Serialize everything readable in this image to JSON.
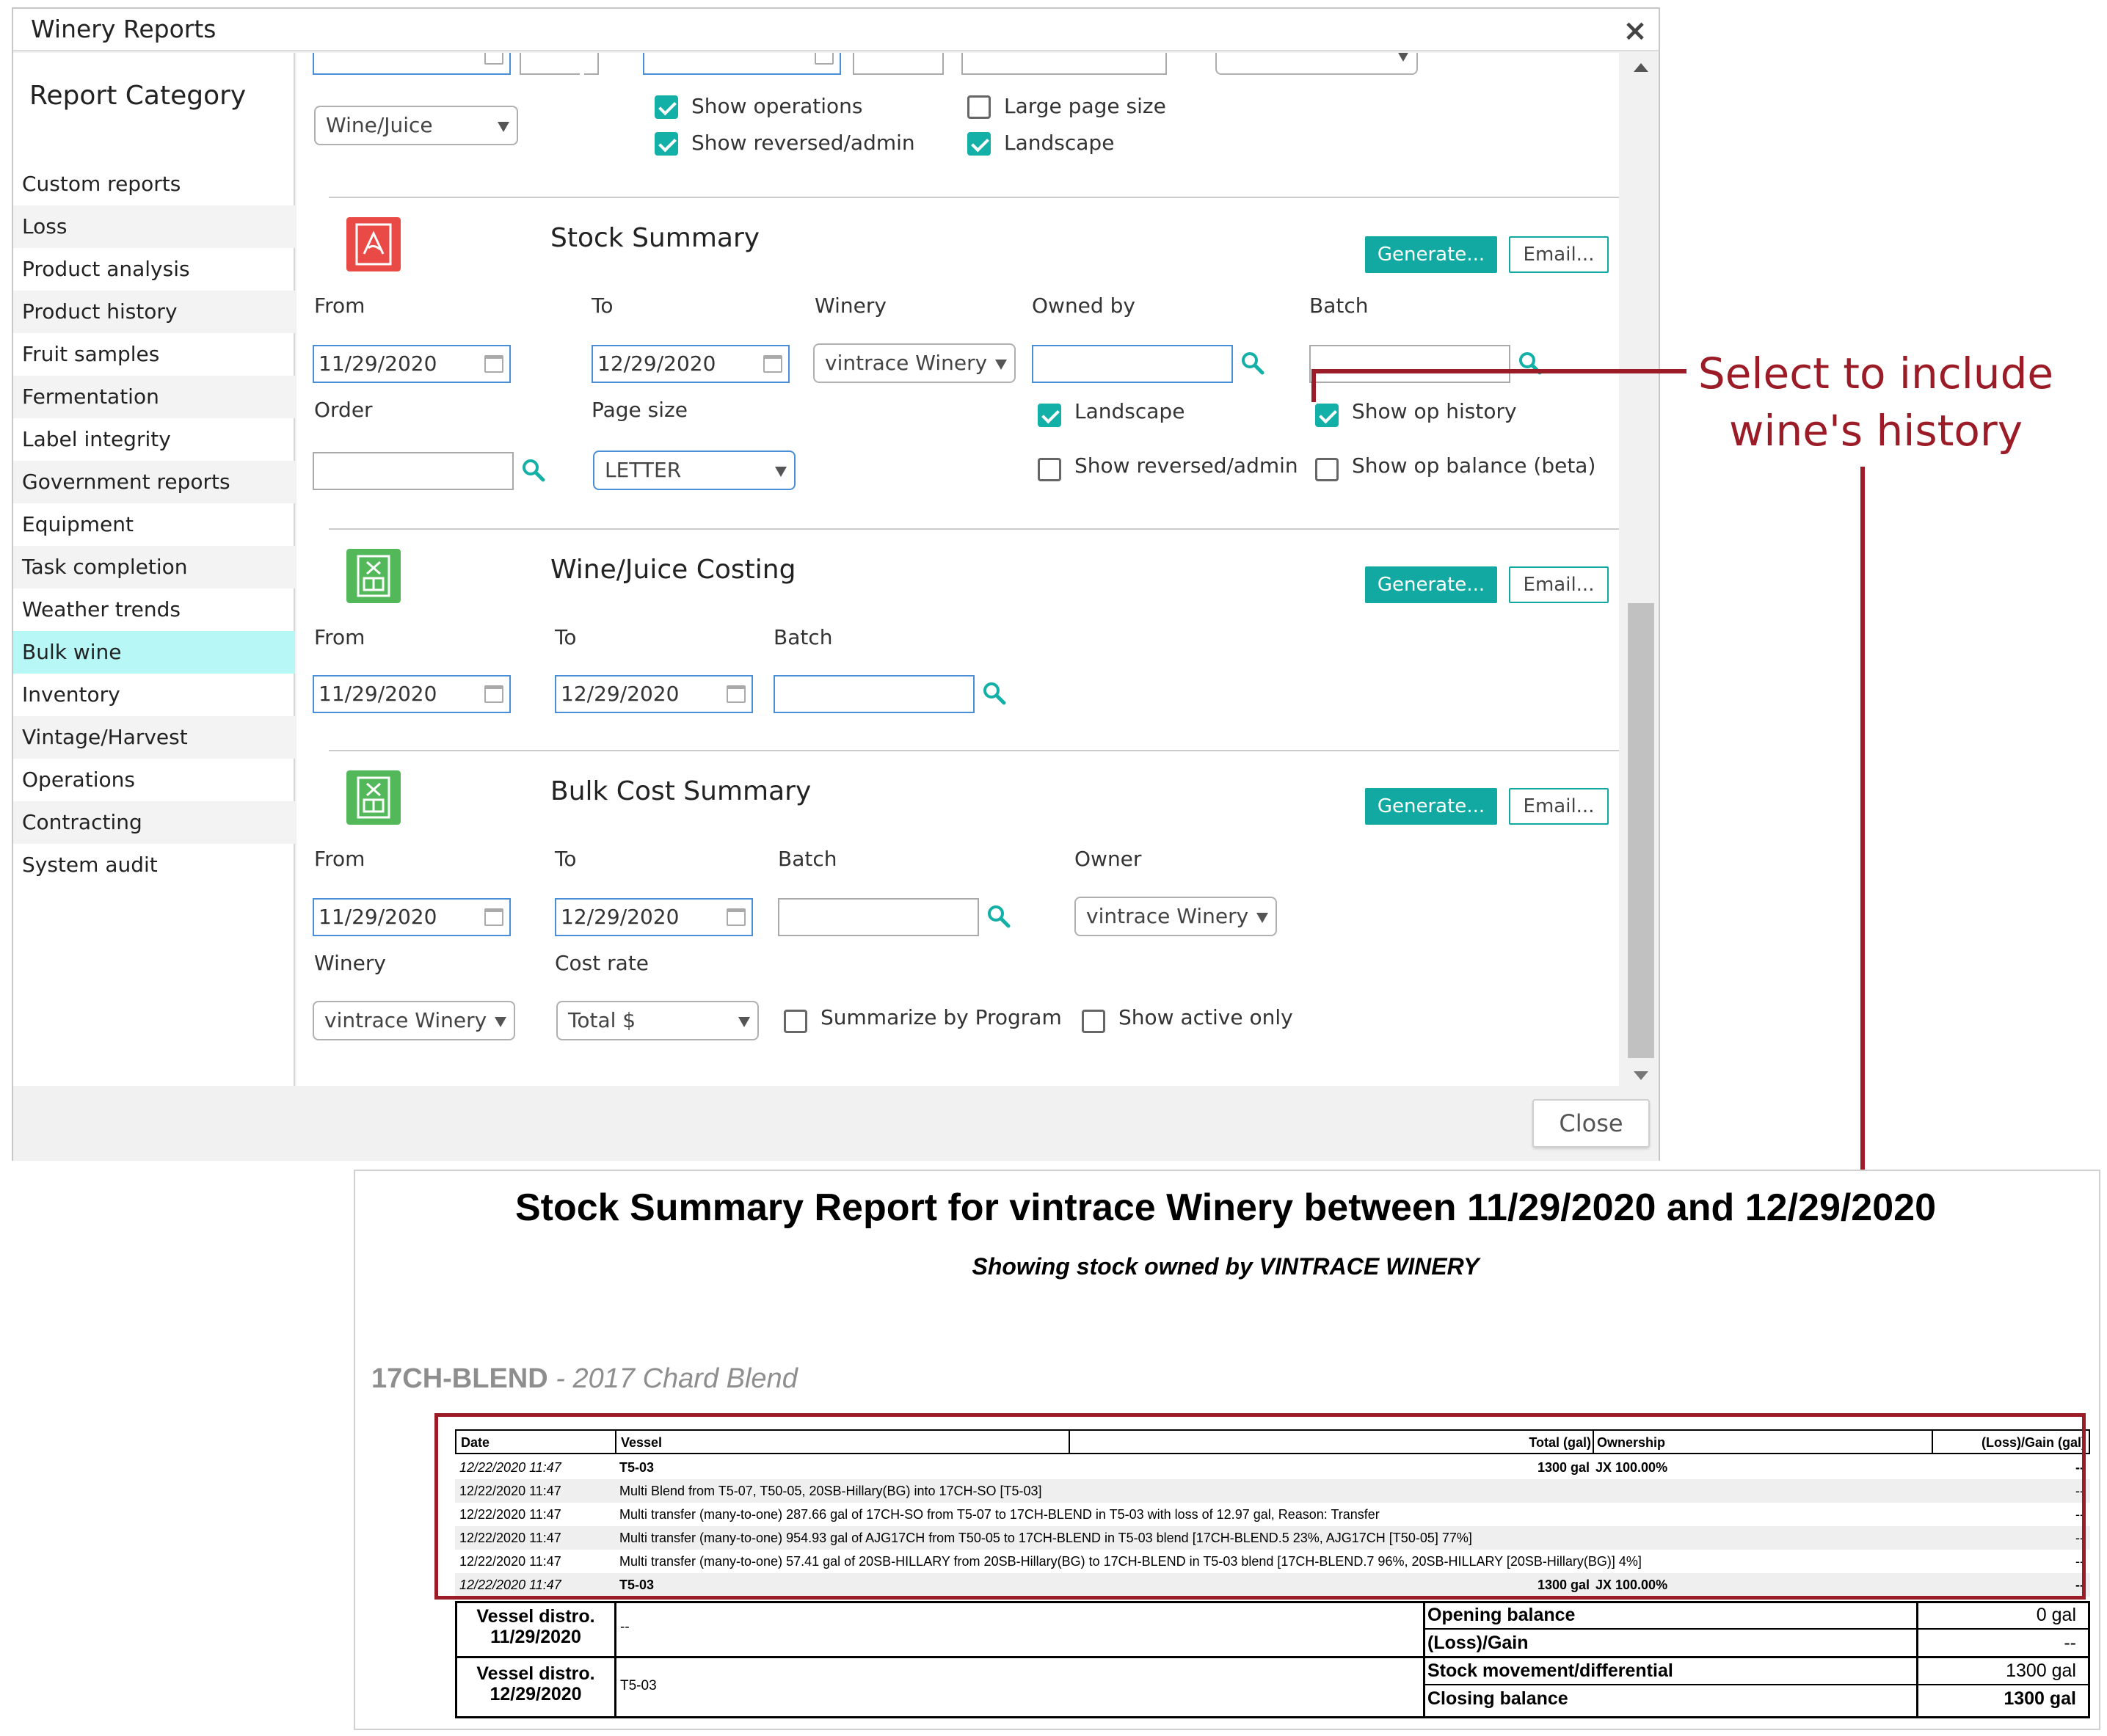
{
  "dialog": {
    "title": "Winery Reports",
    "close_label": "Close"
  },
  "sidebar": {
    "title": "Report Category",
    "items": [
      "Custom reports",
      "Loss",
      "Product analysis",
      "Product history",
      "Fruit samples",
      "Fermentation",
      "Label integrity",
      "Government reports",
      "Equipment",
      "Task completion",
      "Weather trends",
      "Bulk wine",
      "Inventory",
      "Vintage/Harvest",
      "Operations",
      "Contracting",
      "System audit"
    ],
    "active": "Bulk wine"
  },
  "top_section": {
    "type_select": "Wine/Juice",
    "show_operations": "Show operations",
    "show_reversed_admin": "Show reversed/admin",
    "large_page_size": "Large page size",
    "landscape": "Landscape"
  },
  "stock_summary": {
    "title": "Stock Summary",
    "generate": "Generate...",
    "email": "Email...",
    "from_label": "From",
    "from_value": "11/29/2020",
    "to_label": "To",
    "to_value": "12/29/2020",
    "winery_label": "Winery",
    "winery_value": "vintrace Winery",
    "owned_by_label": "Owned by",
    "batch_label": "Batch",
    "order_label": "Order",
    "page_size_label": "Page size",
    "page_size_value": "LETTER",
    "landscape": "Landscape",
    "show_op_history": "Show op history",
    "show_reversed_admin": "Show reversed/admin",
    "show_op_balance": "Show op balance (beta)"
  },
  "costing": {
    "title": "Wine/Juice Costing",
    "generate": "Generate...",
    "email": "Email...",
    "from_label": "From",
    "from_value": "11/29/2020",
    "to_label": "To",
    "to_value": "12/29/2020",
    "batch_label": "Batch"
  },
  "bulk_cost": {
    "title": "Bulk Cost Summary",
    "generate": "Generate...",
    "email": "Email...",
    "from_label": "From",
    "from_value": "11/29/2020",
    "to_label": "To",
    "to_value": "12/29/2020",
    "batch_label": "Batch",
    "owner_label": "Owner",
    "owner_value": "vintrace Winery",
    "winery_label": "Winery",
    "winery_value": "vintrace Winery",
    "cost_rate_label": "Cost rate",
    "cost_rate_value": "Total $",
    "summarize_by_program": "Summarize by Program",
    "show_active_only": "Show active only"
  },
  "annotation": {
    "line1": "Select to include",
    "line2": "wine's history",
    "color": "#9b1b26"
  },
  "report": {
    "title": "Stock Summary Report for vintrace Winery between 11/29/2020 and 12/29/2020",
    "subtitle": "Showing stock owned by VINTRACE WINERY",
    "batch_code": "17CH-BLEND",
    "batch_sep": " - ",
    "batch_desc": "2017 Chard Blend",
    "headers": {
      "date": "Date",
      "vessel": "Vessel",
      "total": "Total (gal)",
      "ownership": "Ownership",
      "loss_gain": "(Loss)/Gain (gal)"
    },
    "rows": [
      {
        "date": "12/22/2020 11:47",
        "vessel": "T5-03",
        "total": "1300 gal",
        "ownership": "JX 100.00%",
        "loss_gain": "--"
      },
      {
        "date": "12/22/2020 11:47",
        "vessel": "Multi Blend from T5-07, T50-05, 20SB-Hillary(BG) into 17CH-SO [T5-03]",
        "total": "",
        "ownership": "",
        "loss_gain": "--"
      },
      {
        "date": "12/22/2020 11:47",
        "vessel": "Multi transfer (many-to-one) 287.66 gal of 17CH-SO from T5-07 to 17CH-BLEND in T5-03 with loss of 12.97 gal, Reason: Transfer",
        "total": "",
        "ownership": "",
        "loss_gain": "--"
      },
      {
        "date": "12/22/2020 11:47",
        "vessel": "Multi transfer (many-to-one) 954.93 gal of AJG17CH from T50-05 to 17CH-BLEND in T5-03 blend [17CH-BLEND.5 23%, AJG17CH [T50-05] 77%]",
        "total": "",
        "ownership": "",
        "loss_gain": "--"
      },
      {
        "date": "12/22/2020 11:47",
        "vessel": "Multi transfer (many-to-one) 57.41 gal of 20SB-HILLARY from 20SB-Hillary(BG) to 17CH-BLEND in T5-03 blend [17CH-BLEND.7 96%, 20SB-HILLARY [20SB-Hillary(BG)] 4%]",
        "total": "",
        "ownership": "",
        "loss_gain": "--"
      },
      {
        "date": "12/22/2020 11:47",
        "vessel": "T5-03",
        "total": "1300 gal",
        "ownership": "JX 100.00%",
        "loss_gain": "--"
      }
    ],
    "summary": {
      "distro1_label": "Vessel distro.",
      "distro1_date": "11/29/2020",
      "distro1_value": "--",
      "distro2_label": "Vessel distro.",
      "distro2_date": "12/29/2020",
      "distro2_value": "T5-03",
      "opening_label": "Opening balance",
      "opening_value": "0 gal",
      "loss_gain_label": "(Loss)/Gain",
      "loss_gain_value": "--",
      "movement_label": "Stock movement/differential",
      "movement_value": "1300 gal",
      "closing_label": "Closing balance",
      "closing_value": "1300 gal"
    }
  }
}
